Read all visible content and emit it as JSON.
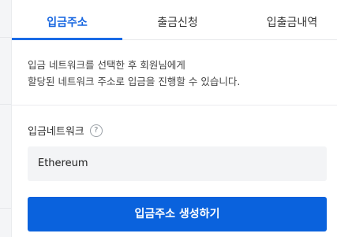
{
  "tabs": [
    {
      "label": "입금주소",
      "active": true
    },
    {
      "label": "출금신청",
      "active": false
    },
    {
      "label": "입출금내역",
      "active": false
    }
  ],
  "description": {
    "line1": "입금 네트워크를 선택한 후 회원님에게",
    "line2": "할당된 네트워크 주소로 입금을 진행할 수 있습니다."
  },
  "network": {
    "label": "입금네트워크",
    "help_icon": "question-circle-icon",
    "value": "Ethereum"
  },
  "create_button": {
    "label": "입금주소 생성하기"
  },
  "colors": {
    "accent": "#1a6be6",
    "button": "#0a62dd",
    "field_bg": "#f3f4f6"
  }
}
